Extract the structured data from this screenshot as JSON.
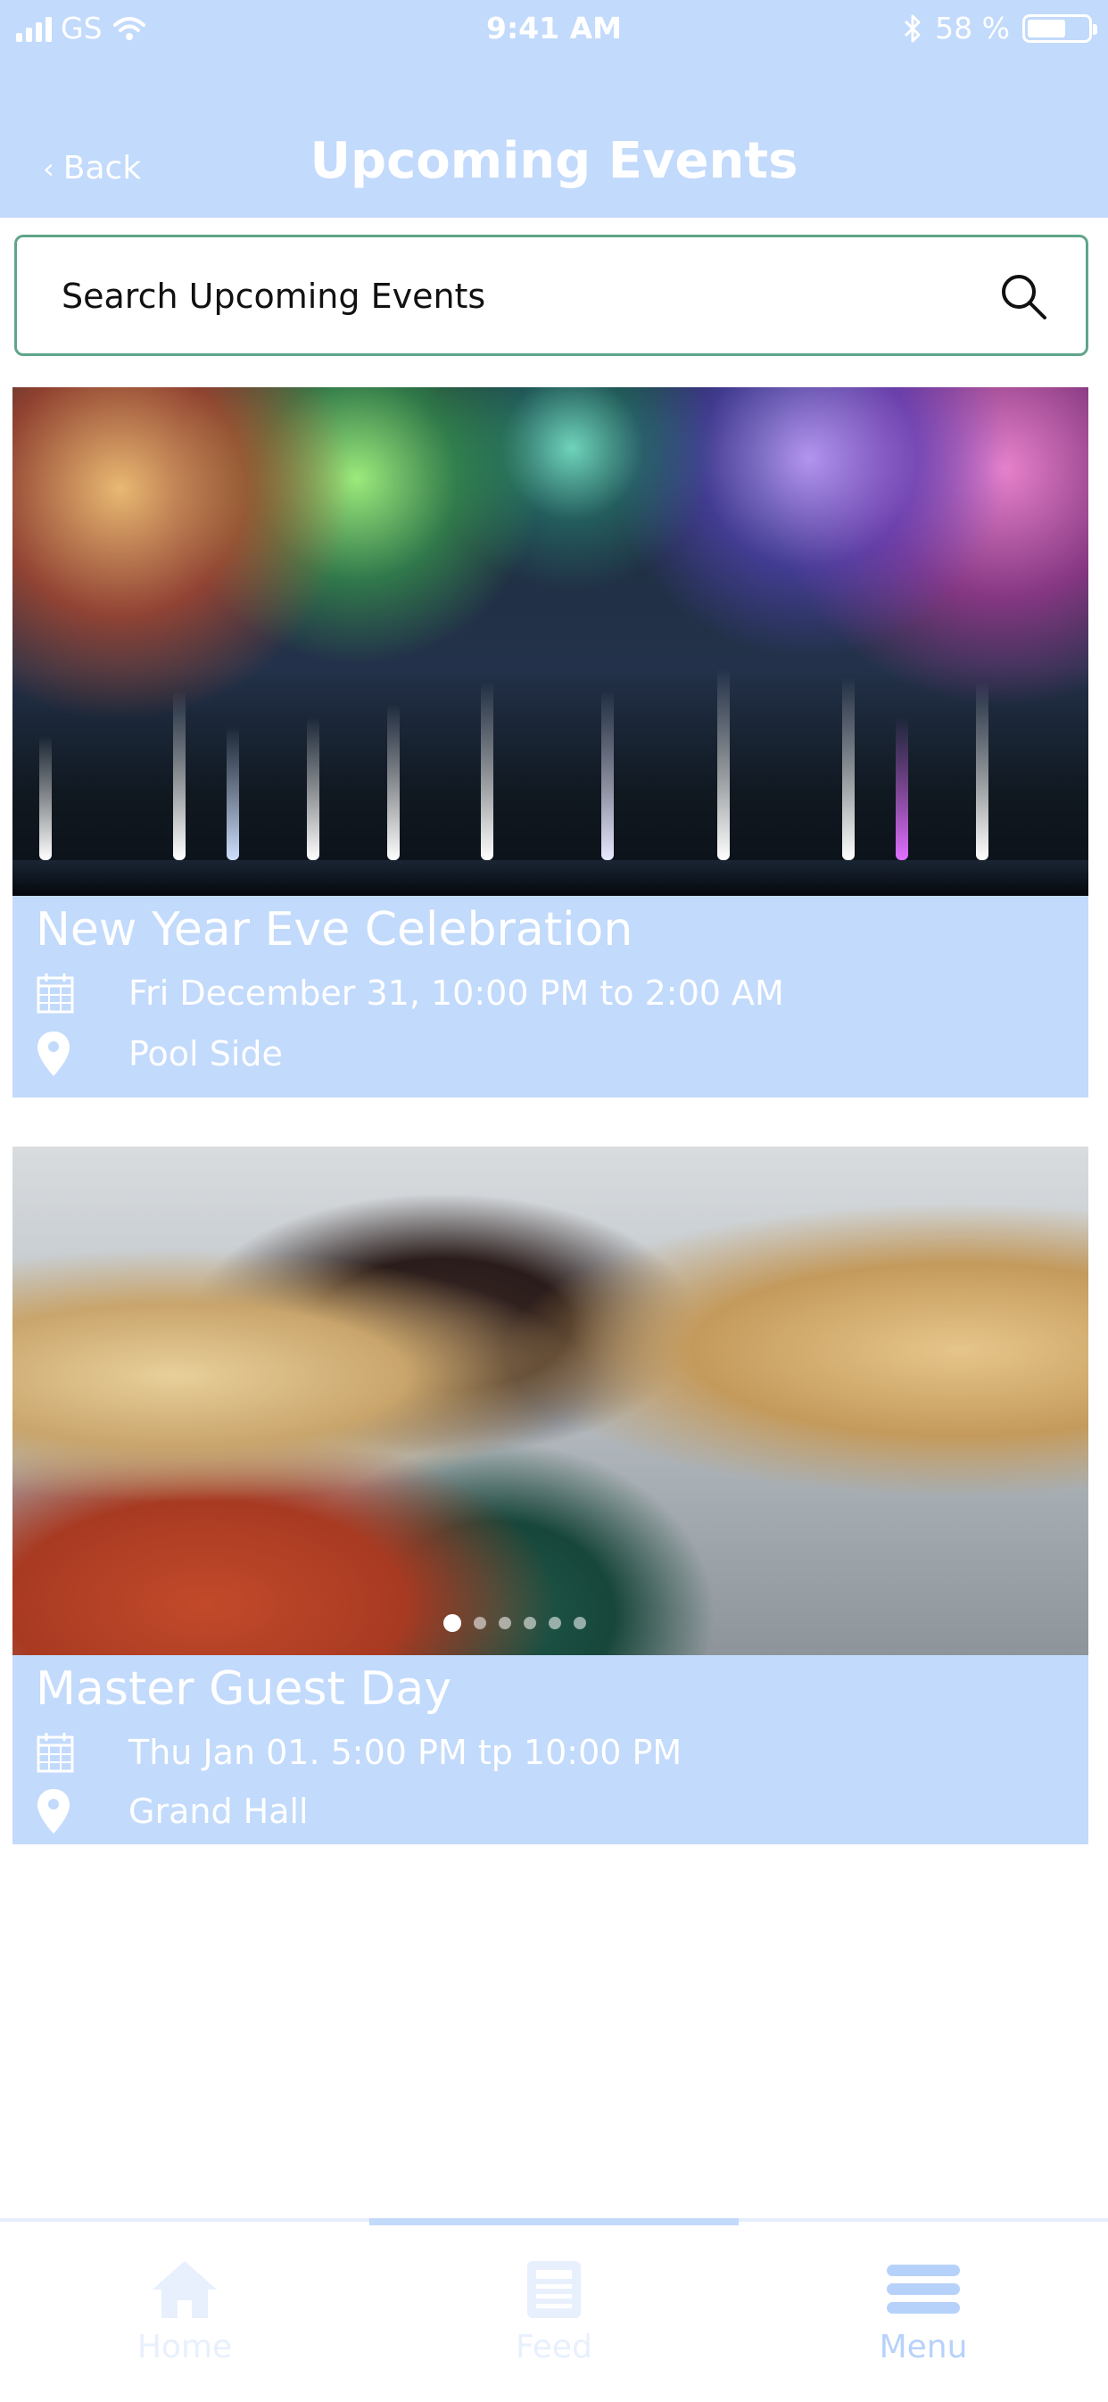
{
  "status_bar": {
    "carrier": "GS",
    "time": "9:41 AM",
    "battery_percent": "58 %"
  },
  "nav": {
    "back_label": "Back",
    "title": "Upcoming Events"
  },
  "search": {
    "placeholder": "Search Upcoming Events"
  },
  "events": [
    {
      "name": "New Year Eve Celebration",
      "date": "Fri December 31, 10:00 PM to 2:00 AM",
      "location": "Pool Side"
    },
    {
      "name": "Master Guest Day",
      "date": "Thu Jan 01. 5:00 PM tp 10:00 PM",
      "location": "Grand Hall"
    }
  ],
  "carousel": {
    "slide_count": 6,
    "active_index": 0
  },
  "tab_bar": {
    "items": [
      {
        "label": "Home"
      },
      {
        "label": "Feed"
      },
      {
        "label": "Menu"
      }
    ]
  },
  "colors": {
    "accent": "#c2dafb",
    "search_border": "#5fa58a"
  }
}
